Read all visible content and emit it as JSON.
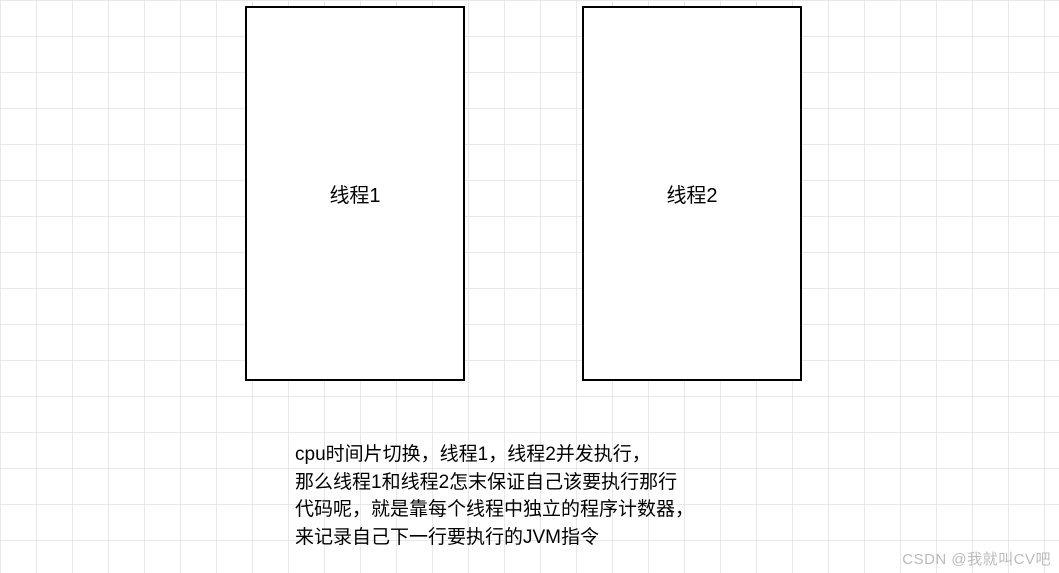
{
  "boxes": {
    "thread1": "线程1",
    "thread2": "线程2"
  },
  "caption": {
    "line1": "cpu时间片切换，线程1，线程2并发执行，",
    "line2": "那么线程1和线程2怎末保证自己该要执行那行",
    "line3": "代码呢，就是靠每个线程中独立的程序计数器，",
    "line4": "来记录自己下一行要执行的JVM指令"
  },
  "watermark": "CSDN @我就叫CV吧"
}
